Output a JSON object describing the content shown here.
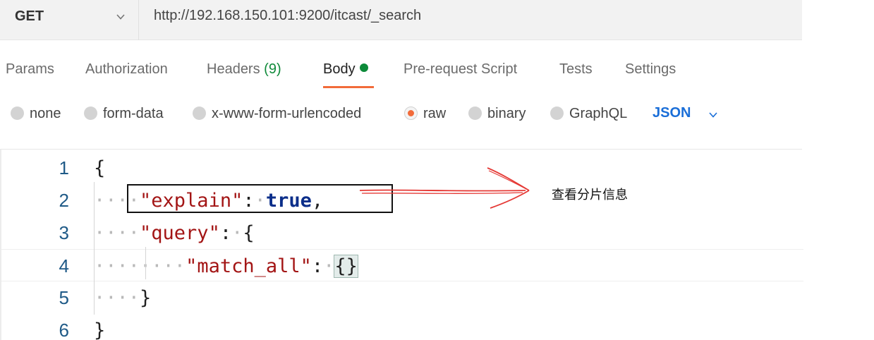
{
  "request": {
    "method": "GET",
    "url": "http://192.168.150.101:9200/itcast/_search"
  },
  "tabs": [
    {
      "label": "Params"
    },
    {
      "label": "Authorization"
    },
    {
      "label": "Headers ",
      "count": "(9)"
    },
    {
      "label": "Body",
      "active": true
    },
    {
      "label": "Pre-request Script"
    },
    {
      "label": "Tests"
    },
    {
      "label": "Settings"
    }
  ],
  "body_types": [
    {
      "label": "none"
    },
    {
      "label": "form-data"
    },
    {
      "label": "x-www-form-urlencoded"
    },
    {
      "label": "raw",
      "selected": true
    },
    {
      "label": "binary"
    },
    {
      "label": "GraphQL"
    }
  ],
  "format": "JSON",
  "editor": {
    "line_numbers": [
      "1",
      "2",
      "3",
      "4",
      "5",
      "6"
    ],
    "tokens": {
      "open_brace": "{",
      "explain_key": "\"explain\"",
      "colon": ":",
      "true_kw": "true",
      "comma": ",",
      "query_key": "\"query\"",
      "match_all_key": "\"match_all\"",
      "empty_obj": "{}",
      "close_brace": "}",
      "ws4": "····",
      "ws1": "·"
    }
  },
  "annotation": {
    "text": "查看分片信息",
    "box_color": "#111111",
    "arrow_color": "#e53935"
  },
  "colors": {
    "accent": "#f26b3a",
    "json_blue": "#1a6ed8",
    "headers_count_green": "#0f8a3a",
    "string_key": "#a31515",
    "keyword": "#0b2e8a"
  }
}
